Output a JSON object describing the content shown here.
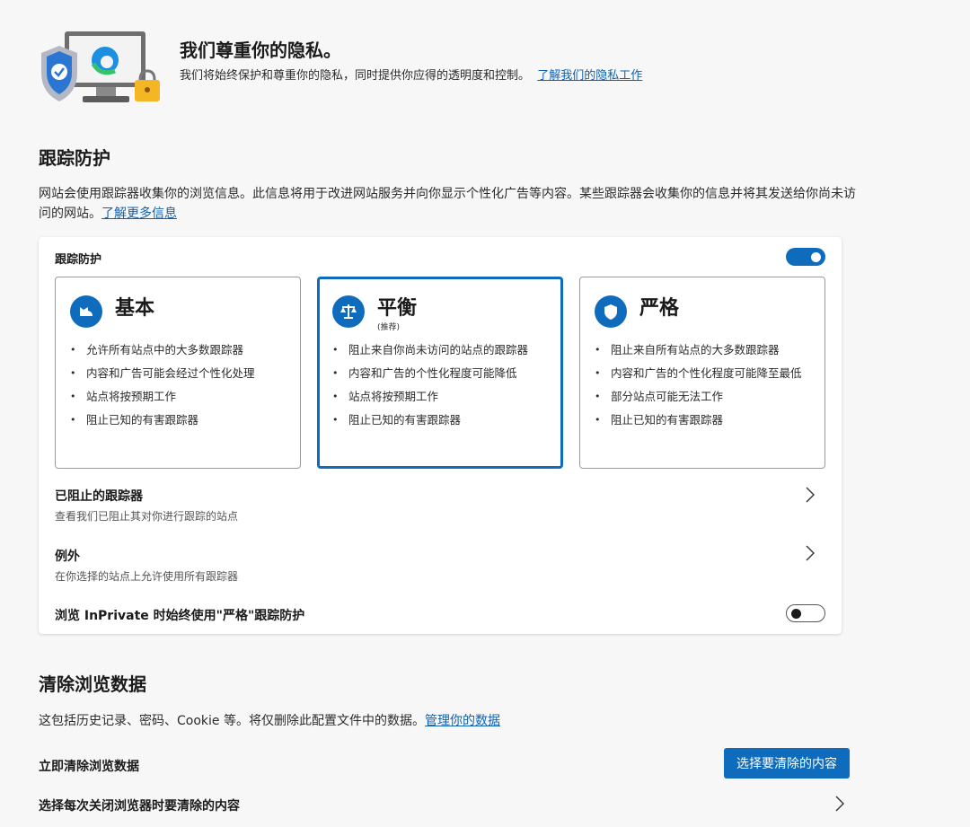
{
  "privacy": {
    "title": "我们尊重你的隐私。",
    "description": "我们将始终保护和尊重你的隐私，同时提供你应得的透明度和控制。",
    "link": "了解我们的隐私工作"
  },
  "tracking": {
    "section_title": "跟踪防护",
    "description": "网站会使用跟踪器收集你的浏览信息。此信息将用于改进网站服务并向你显示个性化广告等内容。某些跟踪器会收集你的信息并将其发送给你尚未访问的网站。",
    "learn_more": "了解更多信息",
    "card_title": "跟踪防护",
    "enabled": true,
    "levels": [
      {
        "name": "基本",
        "sub": "",
        "icon": "cat-icon",
        "selected": false,
        "items": [
          "允许所有站点中的大多数跟踪器",
          "内容和广告可能会经过个性化处理",
          "站点将按预期工作",
          "阻止已知的有害跟踪器"
        ]
      },
      {
        "name": "平衡",
        "sub": "(推荐)",
        "icon": "scale-icon",
        "selected": true,
        "items": [
          "阻止来自你尚未访问的站点的跟踪器",
          "内容和广告的个性化程度可能降低",
          "站点将按预期工作",
          "阻止已知的有害跟踪器"
        ]
      },
      {
        "name": "严格",
        "sub": "",
        "icon": "shield-icon",
        "selected": false,
        "items": [
          "阻止来自所有站点的大多数跟踪器",
          "内容和广告的个性化程度可能降至最低",
          "部分站点可能无法工作",
          "阻止已知的有害跟踪器"
        ]
      }
    ],
    "blocked": {
      "title": "已阻止的跟踪器",
      "subtitle": "查看我们已阻止其对你进行跟踪的站点"
    },
    "exceptions": {
      "title": "例外",
      "subtitle": "在你选择的站点上允许使用所有跟踪器"
    },
    "inprivate": {
      "label": "浏览 InPrivate 时始终使用\"严格\"跟踪防护",
      "enabled": false
    }
  },
  "clear": {
    "section_title": "清除浏览数据",
    "description": "这包括历史记录、密码、Cookie 等。将仅删除此配置文件中的数据。",
    "manage_link": "管理你的数据",
    "clear_now_label": "立即清除浏览数据",
    "clear_button": "选择要清除的内容",
    "on_close_label": "选择每次关闭浏览器时要清除的内容"
  },
  "colors": {
    "accent": "#0f6cbd",
    "link": "#0f62b5"
  }
}
